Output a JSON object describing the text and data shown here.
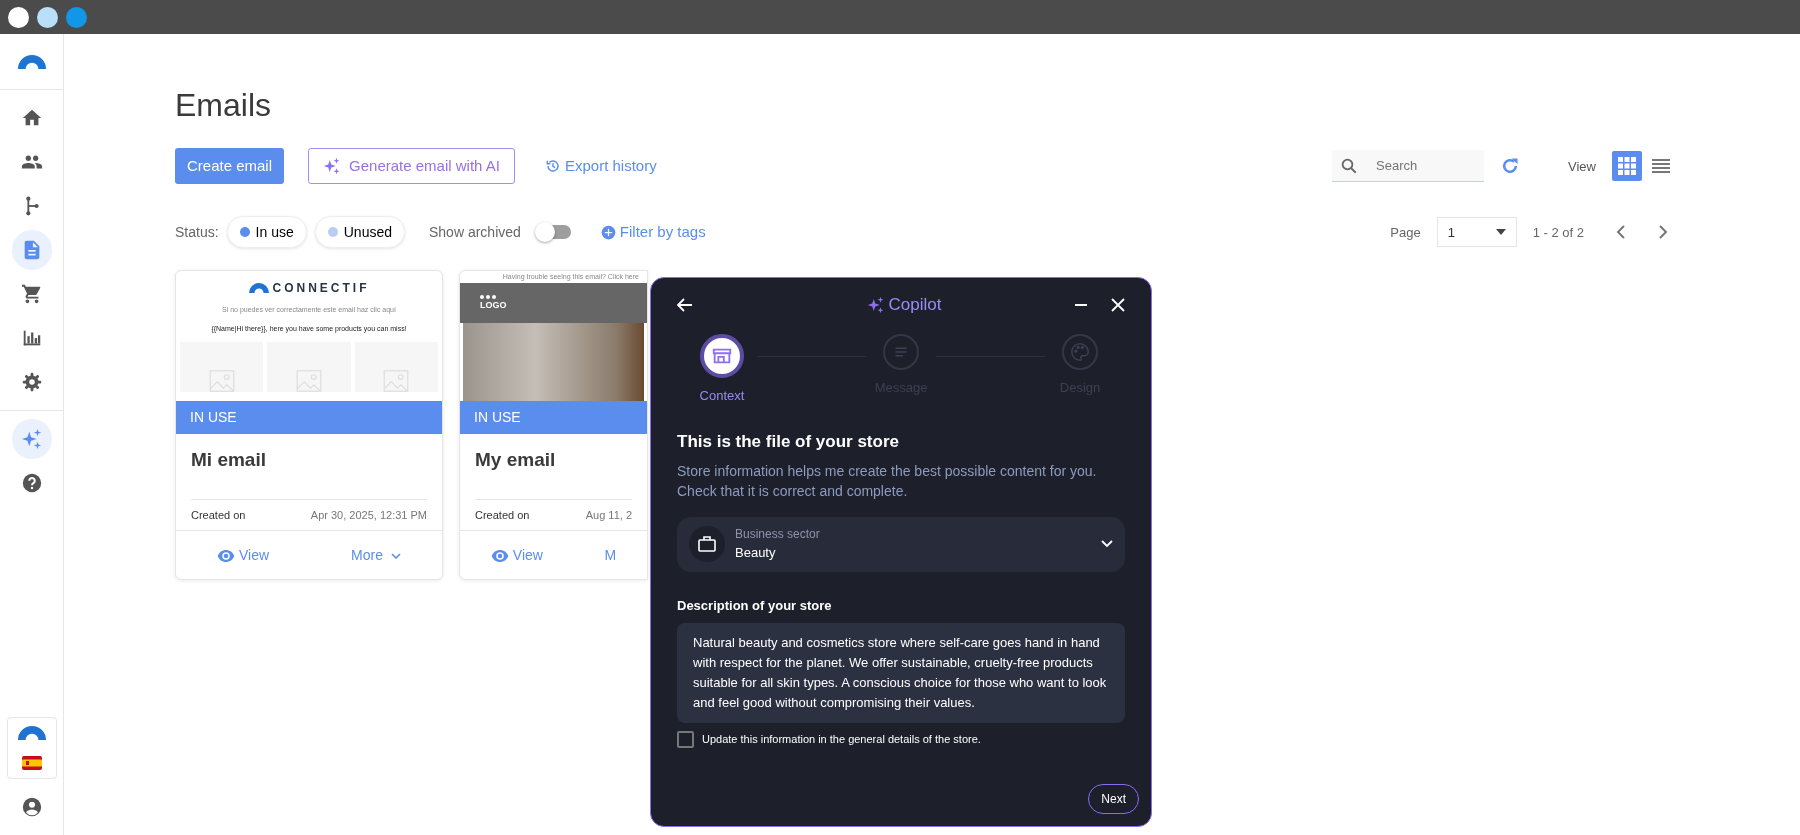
{
  "sidebar": {
    "top": [
      {
        "kind": "home",
        "selected": false
      },
      {
        "kind": "people",
        "selected": false
      },
      {
        "kind": "flow",
        "selected": false
      },
      {
        "kind": "document",
        "selected": true
      },
      {
        "kind": "cart",
        "selected": false
      },
      {
        "kind": "chart",
        "selected": false
      },
      {
        "kind": "settings",
        "selected": false
      }
    ],
    "extra": [
      {
        "kind": "sparkle",
        "selected": true
      },
      {
        "kind": "help",
        "selected": false
      }
    ]
  },
  "page": {
    "title": "Emails"
  },
  "toolbar": {
    "create": "Create email",
    "generate": "Generate email with AI",
    "export": "Export history",
    "search": {
      "placeholder": "Search"
    },
    "view_label": "View",
    "views": [
      {
        "kind": "grid",
        "selected": true
      },
      {
        "kind": "list",
        "selected": false
      }
    ]
  },
  "filters": {
    "status_label": "Status:",
    "statuses": [
      {
        "label": "In use",
        "color": "#5b8def"
      },
      {
        "label": "Unused",
        "color": "#b9cdf4"
      }
    ],
    "show_archived": {
      "label": "Show archived",
      "on": false
    },
    "filter_tags": "Filter by tags"
  },
  "pagination": {
    "label": "Page",
    "value": "1",
    "range": "1 - 2 of 2"
  },
  "cards": [
    {
      "kind": "products",
      "preview": {
        "brand": "CONNECTIF",
        "notice": "Si no puedes ver correctamente este email haz clic aquí",
        "greeting": "{{Name|Hi there}}, here you have some products you can miss!"
      },
      "status": "IN USE",
      "name": "Mi email",
      "created_label": "Created on",
      "created": "Apr 30, 2025, 12:31 PM",
      "view": "View",
      "more": "More"
    },
    {
      "kind": "photo",
      "preview": {
        "notice": "Having trouble seeing this email? Click here",
        "logo": "LOGO"
      },
      "status": "IN USE",
      "name": "My email",
      "created_label": "Created on",
      "created": "Aug 11, 2",
      "view": "View",
      "more": "M"
    }
  ],
  "copilot": {
    "title": "Copilot",
    "steps": [
      {
        "kind": "store",
        "label": "Context",
        "selected": true
      },
      {
        "kind": "lines",
        "label": "Message",
        "selected": false
      },
      {
        "kind": "palette",
        "label": "Design",
        "selected": false
      }
    ],
    "heading": "This is the file of your store",
    "intro": "Store information helps me create the best possible content for you. Check that it is correct and complete.",
    "sector": {
      "label": "Business sector",
      "value": "Beauty"
    },
    "description": {
      "label": "Description of your store",
      "value": "Natural beauty and cosmetics store where self-care goes hand in hand with respect for the planet. We offer sustainable, cruelty-free products suitable for all skin types. A conscious choice for those who want to look and feel good without compromising their values."
    },
    "update": {
      "label": "Update this information in the general details of the store.",
      "checked": false
    },
    "next": "Next"
  }
}
